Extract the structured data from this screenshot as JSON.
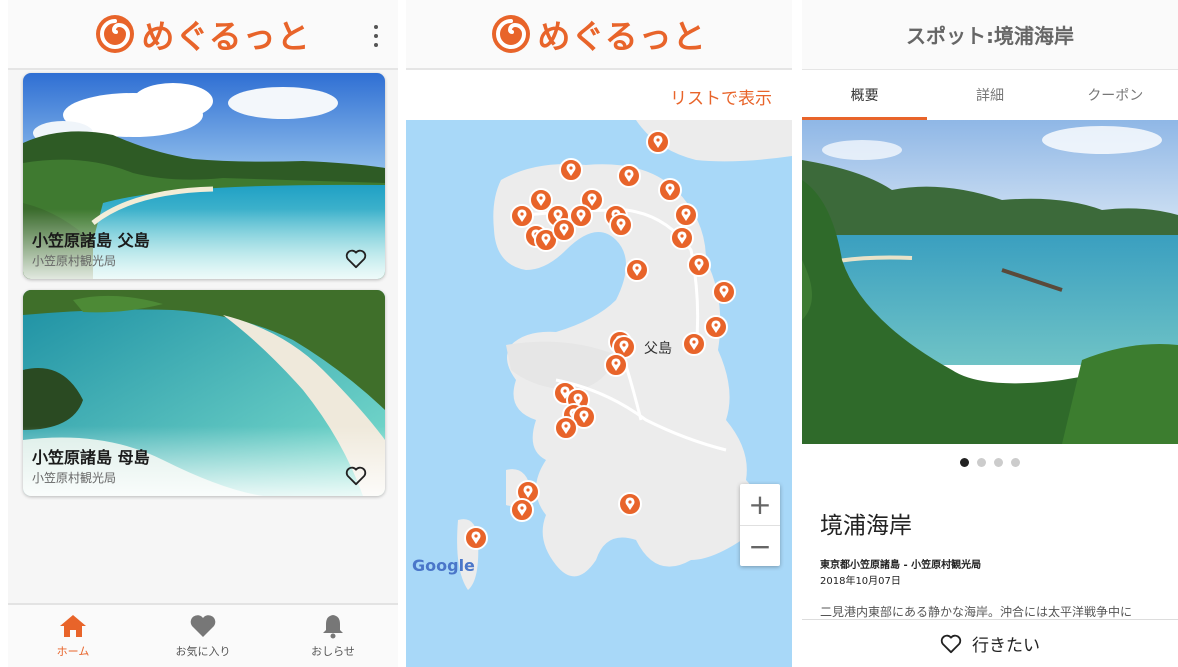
{
  "brand": {
    "name": "めぐるっと",
    "color": "#e8642a"
  },
  "home": {
    "cards": [
      {
        "title": "小笠原諸島 父島",
        "subtitle": "小笠原村観光局"
      },
      {
        "title": "小笠原諸島 母島",
        "subtitle": "小笠原村観光局"
      }
    ],
    "nav": [
      {
        "label": "ホーム",
        "icon": "home-icon",
        "active": true
      },
      {
        "label": "お気に入り",
        "icon": "heart-icon",
        "active": false
      },
      {
        "label": "おしらせ",
        "icon": "bell-icon",
        "active": false
      }
    ]
  },
  "map_screen": {
    "list_link": "リストで表示",
    "island_label": "父島",
    "zoom_in": "+",
    "zoom_out": "−",
    "attribution": "Google"
  },
  "detail": {
    "title": "スポット:境浦海岸",
    "tabs": [
      "概要",
      "詳細",
      "クーポン"
    ],
    "active_tab": 0,
    "carousel": {
      "count": 4,
      "current": 1
    },
    "name": "境浦海岸",
    "location": "東京都小笠原諸島 - 小笠原村観光局",
    "date": "2018年10月07日",
    "description": "二見港内東部にある静かな海岸。沖合には太平洋戦争中に",
    "want_label": "行きたい"
  }
}
